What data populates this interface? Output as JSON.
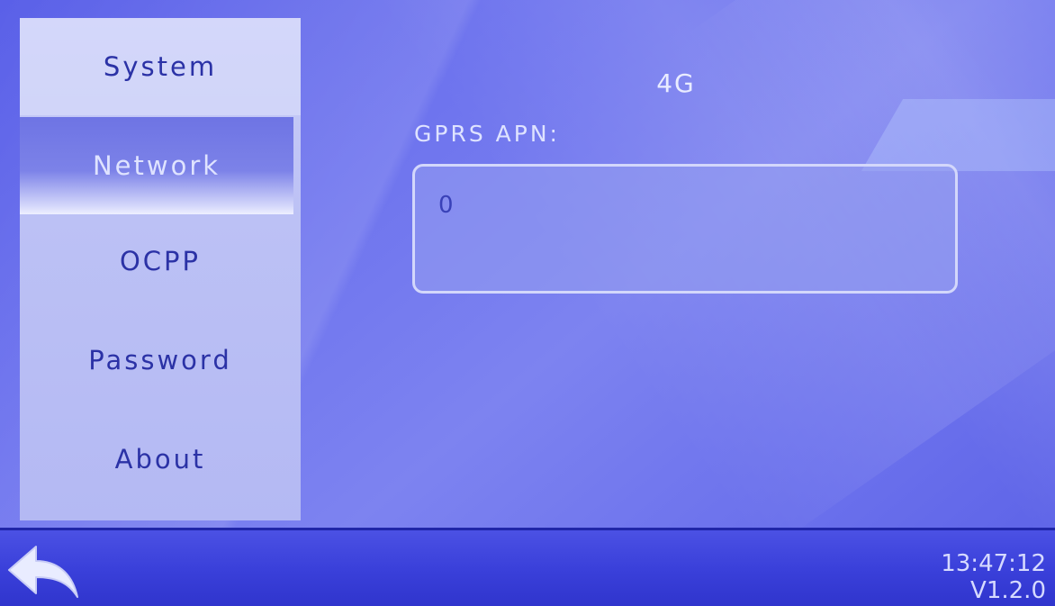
{
  "sidebar": {
    "items": [
      {
        "label": "System"
      },
      {
        "label": "Network"
      },
      {
        "label": "OCPP"
      },
      {
        "label": "Password"
      },
      {
        "label": "About"
      }
    ],
    "selected": "Network"
  },
  "main": {
    "section_title": "4G",
    "apn_label": "GPRS APN:",
    "apn_value": "0"
  },
  "footer": {
    "time": "13:47:12",
    "version": "V1.2.0",
    "back_icon": "back-arrow-icon"
  },
  "colors": {
    "background": "#6a70ec",
    "sidebar": "#bcc1f5",
    "selected_item": "#6e74e4",
    "text_dark": "#2b32a6",
    "text_light": "#dfe3ff",
    "bottom_bar": "#3a40da"
  }
}
